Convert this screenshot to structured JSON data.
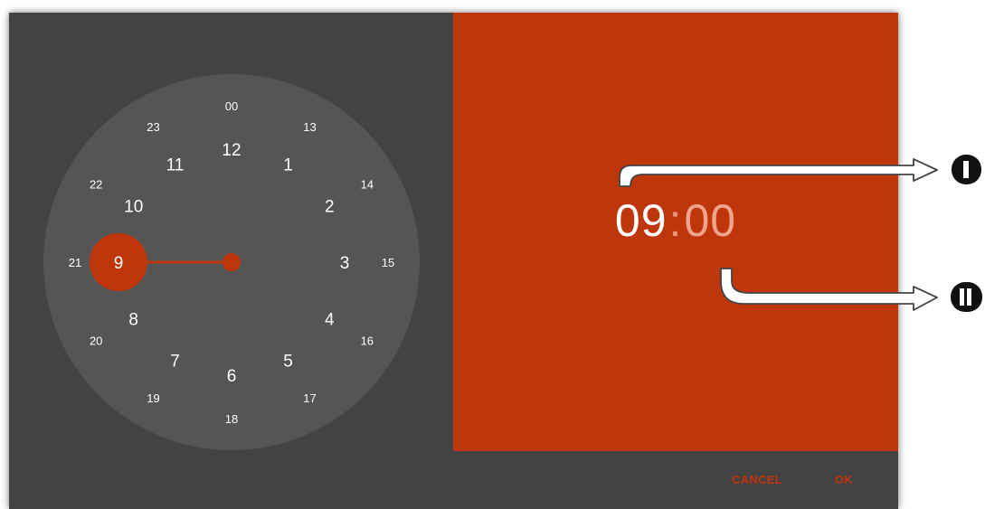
{
  "time": {
    "hours": "09",
    "separator": ":",
    "minutes": "00"
  },
  "clock": {
    "selected_hour": "9",
    "outer_numbers": [
      "12",
      "1",
      "2",
      "3",
      "4",
      "5",
      "6",
      "7",
      "8",
      "9",
      "10",
      "11"
    ],
    "inner_numbers": [
      "00",
      "13",
      "14",
      "15",
      "16",
      "17",
      "18",
      "19",
      "20",
      "21",
      "22",
      "23"
    ]
  },
  "buttons": {
    "cancel": "CANCEL",
    "ok": "OK"
  },
  "colors": {
    "accent": "#bf360c",
    "dialog_bg": "#434343",
    "dial_bg": "#555555"
  }
}
